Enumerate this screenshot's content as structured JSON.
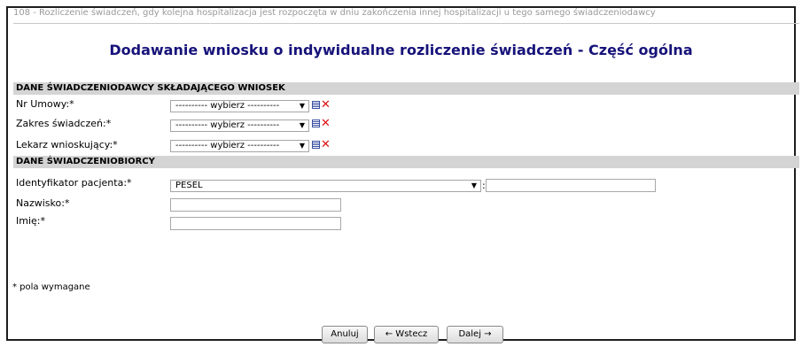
{
  "breadcrumb": "108 - Rozliczenie świadczeń, gdy kolejna hospitalizacja jest rozpoczęta w dniu zakończenia innej hospitalizacji u tego samego świadczeniodawcy",
  "page_title": "Dodawanie wniosku o indywidualne rozliczenie świadczeń - Część ogólna",
  "section_provider": {
    "header": "DANE ŚWIADCZENIODAWCY SKŁADAJĄCEGO WNIOSEK",
    "fields": [
      {
        "label": "Nr Umowy:*",
        "value": "---------- wybierz ----------"
      },
      {
        "label": "Zakres świadczeń:*",
        "value": "---------- wybierz ----------"
      },
      {
        "label": "Lekarz wnioskujący:*",
        "value": "---------- wybierz ----------"
      }
    ]
  },
  "section_patient": {
    "header": "DANE ŚWIADCZENIOBIORCY",
    "id_label": "Identyfikator pacjenta:*",
    "id_type": "PESEL",
    "id_separator": ":",
    "id_value": "",
    "surname_label": "Nazwisko:*",
    "surname_value": "",
    "name_label": "Imię:*",
    "name_value": ""
  },
  "required_note": "* pola wymagane",
  "buttons": {
    "cancel": "Anuluj",
    "back": "← Wstecz",
    "next": "Dalej →"
  },
  "colors": {
    "title": "#17137a",
    "section_bg": "#d4d4d4",
    "clear_icon": "#dd1111"
  }
}
